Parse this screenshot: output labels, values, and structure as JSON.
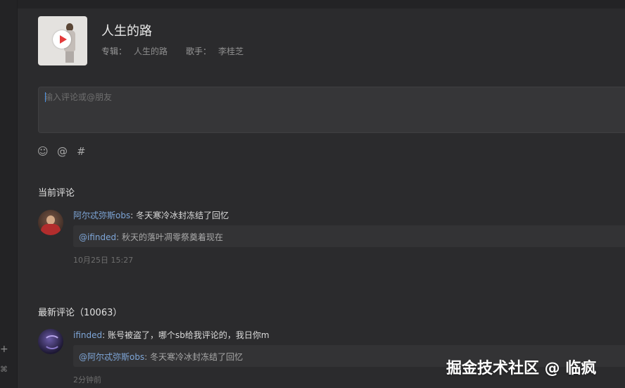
{
  "song": {
    "title": "人生的路",
    "album_label": "专辑：",
    "album": "人生的路",
    "artist_label": "歌手：",
    "artist": "李桂芝"
  },
  "comment_input": {
    "placeholder": "输入评论或@朋友",
    "value": ""
  },
  "toolbar": {
    "emoji_icon": "☺",
    "mention_icon": "@",
    "hashtag_icon": "#"
  },
  "current_comments": {
    "title": "当前评论",
    "items": [
      {
        "user": "阿尔忒弥斯obs",
        "separator": ": ",
        "text": "冬天寒冷冰封冻结了回忆",
        "reply_user": "@ifinded",
        "reply_separator": ": ",
        "reply_text": "秋天的落叶凋零祭奠着现在",
        "time": "10月25日 15:27"
      }
    ]
  },
  "latest_comments": {
    "title": "最新评论（10063）",
    "items": [
      {
        "user": "ifinded",
        "separator": ": ",
        "text": "账号被盗了，哪个sb给我评论的，我日你m",
        "reply_user": "@阿尔忒弥斯obs",
        "reply_separator": ": ",
        "reply_text": "冬天寒冷冰封冻结了回忆",
        "time": "2分钟前"
      }
    ]
  },
  "sidebar": {
    "add_icon": "+",
    "folder_icon": "⌘"
  },
  "watermark": "掘金技术社区 @ 临疯"
}
